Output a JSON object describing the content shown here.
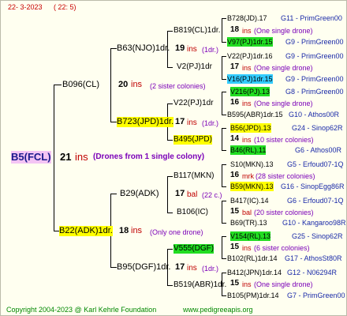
{
  "header": {
    "date": "22-  3-2023",
    "time": "( 22:  5)"
  },
  "root": {
    "name": "B5(FCL)",
    "num": "21",
    "ins": "ins",
    "note": "(Drones from 1 single colony)"
  },
  "gen1": [
    {
      "name": "B096(CL)",
      "num": "20",
      "ins": "ins",
      "note": "(2 sister colonies)"
    },
    {
      "name": "B22(ADK)1dr.",
      "num": "18",
      "ins": "ins",
      "note": "(Only one drone)"
    }
  ],
  "gen2": [
    {
      "name": "B63(NJO)1dr.",
      "num": "19",
      "ins": "ins",
      "note": "(1dr.)"
    },
    {
      "name": "B723(JPD)1dr.",
      "num": "17",
      "ins": "ins",
      "note": "(1dr.)"
    },
    {
      "name": "B29(ADK)",
      "num": "17",
      "ins": "bal",
      "note": "(22 c.)"
    },
    {
      "name": "B95(DGF)1dr.",
      "num": "17",
      "ins": "ins",
      "note": "(1dr.)"
    }
  ],
  "gen3": [
    {
      "name": "B819(CL)1dr."
    },
    {
      "name": "V2(PJ)1dr"
    },
    {
      "name": "V22(PJ)1dr"
    },
    {
      "name": "B495(JPD)"
    },
    {
      "name": "B117(MKN)"
    },
    {
      "name": "B106(IC)"
    },
    {
      "name": "V555(DGF)"
    },
    {
      "name": "B519(ABR)1dr."
    }
  ],
  "gen4": [
    {
      "name": "B728(JD).17",
      "code": "G11 - PrimGreen00"
    },
    {
      "name": "18",
      "ins": "ins",
      "note": "(One single drone)"
    },
    {
      "name": "V97(PJ)1dr.15",
      "code": "G9 - PrimGreen00"
    },
    {
      "name": "V22(PJ)1dr.16",
      "code": "G9 - PrimGreen00"
    },
    {
      "name": "17",
      "ins": "ins",
      "note": "(One single drone)"
    },
    {
      "name": "V16(PJ)1dr.15",
      "code": "G9 - PrimGreen00"
    },
    {
      "name": "V216(PJ).13",
      "code": "G8 - PrimGreen00"
    },
    {
      "name": "16",
      "ins": "ins",
      "note": "(One single drone)"
    },
    {
      "name": "B595(ABR)1dr.15",
      "code": "G10 - Athos00R"
    },
    {
      "name": "B56(JPD).13",
      "code": "G24 - Sinop62R"
    },
    {
      "name": "14",
      "ins": "ins",
      "note": "(10 sister colonies)"
    },
    {
      "name": "B46(RL).11",
      "code": "G6 - Athos00R"
    },
    {
      "name": "S10(MKN).13",
      "code": "G5 - Erfoud07-1Q"
    },
    {
      "name": "16",
      "ins": "mrk",
      "note": "(28 sister colonies)"
    },
    {
      "name": "B59(MKN).13",
      "code": "G16 - SinopEgg86R"
    },
    {
      "name": "B417(IC).14",
      "code": "G6 - Erfoud07-1Q"
    },
    {
      "name": "15",
      "ins": "bal",
      "note": "(20 sister colonies)"
    },
    {
      "name": "B69(TR).13",
      "code": "G10 - Kangaroo98R"
    },
    {
      "name": "V154(RL).13",
      "code": "G25 - Sinop62R"
    },
    {
      "name": "15",
      "ins": "ins",
      "note": "(6 sister colonies)"
    },
    {
      "name": "B102(RL)1dr.14",
      "code": "G17 - AthosSt80R"
    },
    {
      "name": "B412(JPN)1dr.14",
      "code": "G12 - N06294R"
    },
    {
      "name": "15",
      "ins": "ins",
      "note": "(One single drone)"
    },
    {
      "name": "B105(PM)1dr.14",
      "code": "G7 - PrimGreen00"
    }
  ],
  "footer": {
    "copyright": "Copyright 2004-2023 @ Karl Kehrle Foundation",
    "url": "www.pedigreeapis.org"
  }
}
